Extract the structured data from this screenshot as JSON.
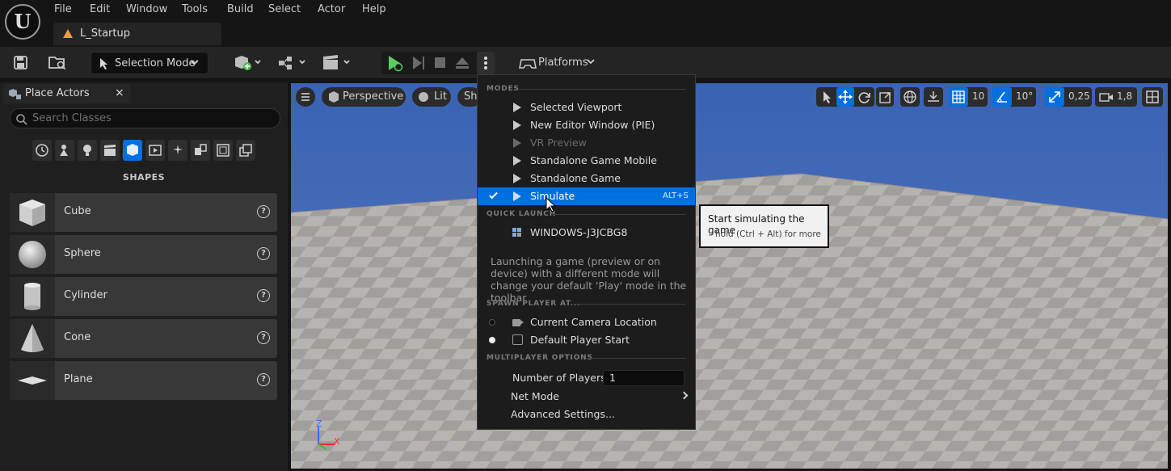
{
  "menu": {
    "items": [
      "File",
      "Edit",
      "Window",
      "Tools",
      "Build",
      "Select",
      "Actor",
      "Help"
    ],
    "level_tab": "L_Startup"
  },
  "toolbar": {
    "selection_mode": "Selection Mode",
    "platforms": "Platforms"
  },
  "place_actors": {
    "tab_title": "Place Actors",
    "close": "×",
    "search_placeholder": "Search Classes",
    "section_title": "SHAPES",
    "shapes": [
      {
        "label": "Cube",
        "help": "?"
      },
      {
        "label": "Sphere",
        "help": "?"
      },
      {
        "label": "Cylinder",
        "help": "?"
      },
      {
        "label": "Cone",
        "help": "?"
      },
      {
        "label": "Plane",
        "help": "?"
      }
    ]
  },
  "viewport": {
    "perspective": "Perspective",
    "lit": "Lit",
    "show": "Sh",
    "grid_snap": "10",
    "rotation_snap": "10°",
    "scale_snap": "0,25",
    "camera_speed": "1,8",
    "axis_z": "Z",
    "axis_x": "X"
  },
  "play_menu": {
    "modes_header": "MODES",
    "modes": [
      {
        "label": "Selected Viewport",
        "icon": "play-icon",
        "enabled": true
      },
      {
        "label": "New Editor Window (PIE)",
        "icon": "window-play-icon",
        "enabled": true
      },
      {
        "label": "VR Preview",
        "icon": "vr-play-icon",
        "enabled": false
      },
      {
        "label": "Standalone Game Mobile",
        "icon": "mobile-play-icon",
        "enabled": true
      },
      {
        "label": "Standalone Game",
        "icon": "standalone-play-icon",
        "enabled": true
      },
      {
        "label": "Simulate",
        "icon": "simulate-icon",
        "enabled": true,
        "selected": true,
        "shortcut": "ALT+S"
      }
    ],
    "quick_launch_header": "QUICK LAUNCH",
    "quick_launch_device": "WINDOWS-J3JCBG8",
    "description": "Launching a game (preview or on device) with a different mode will change your default 'Play' mode in the toolbar",
    "spawn_header": "SPAWN PLAYER AT...",
    "spawn_options": [
      {
        "label": "Current Camera Location",
        "selected": false
      },
      {
        "label": "Default Player Start",
        "selected": true
      }
    ],
    "multiplayer_header": "MULTIPLAYER OPTIONS",
    "number_of_players_label": "Number of Players",
    "number_of_players_value": "1",
    "net_mode": "Net Mode",
    "advanced_settings": "Advanced Settings..."
  },
  "tooltip": {
    "title": "Start simulating the game",
    "hint": "hold (Ctrl + Alt) for more"
  },
  "colors": {
    "accent": "#0070e0",
    "play_green": "#5ec95e",
    "sky": "#3f6ab8"
  }
}
